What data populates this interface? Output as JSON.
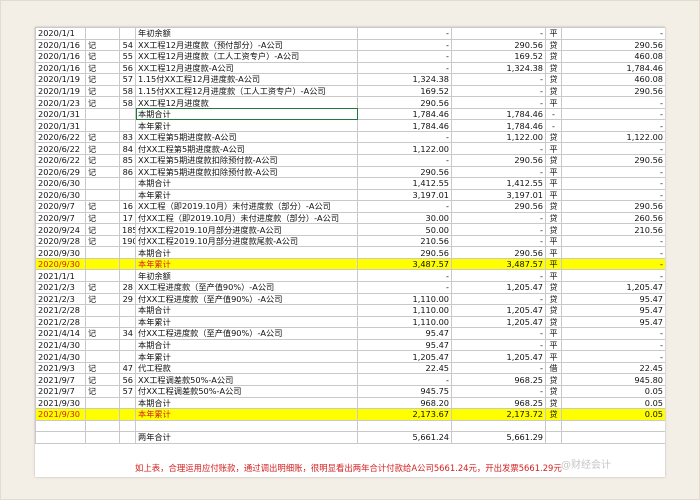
{
  "rows": [
    {
      "date": "2020/1/1",
      "type": "",
      "no": "",
      "summary": "年初余额",
      "debit": "-",
      "credit": "-",
      "dir": "平",
      "balance": "-"
    },
    {
      "date": "2020/1/16",
      "type": "记",
      "no": "54",
      "summary": "XX工程12月进度款（预付部分）-A公司",
      "debit": "-",
      "credit": "290.56",
      "dir": "贷",
      "balance": "290.56"
    },
    {
      "date": "2020/1/16",
      "type": "记",
      "no": "55",
      "summary": "XX工程12月进度款（工人工资专户）-A公司",
      "debit": "-",
      "credit": "169.52",
      "dir": "贷",
      "balance": "460.08"
    },
    {
      "date": "2020/1/16",
      "type": "记",
      "no": "56",
      "summary": "XX工程12月进度款-A公司",
      "debit": "-",
      "credit": "1,324.38",
      "dir": "贷",
      "balance": "1,784.46"
    },
    {
      "date": "2020/1/19",
      "type": "记",
      "no": "57",
      "summary": "1.15付XX工程12月进度款-A公司",
      "debit": "1,324.38",
      "credit": "-",
      "dir": "贷",
      "balance": "460.08"
    },
    {
      "date": "2020/1/19",
      "type": "记",
      "no": "58",
      "summary": "1.15付XX工程12月进度款（工人工资专户）-A公司",
      "debit": "169.52",
      "credit": "-",
      "dir": "贷",
      "balance": "290.56"
    },
    {
      "date": "2020/1/23",
      "type": "记",
      "no": "58",
      "summary": "XX工程12月进度款",
      "debit": "290.56",
      "credit": "-",
      "dir": "平",
      "balance": "-"
    },
    {
      "date": "2020/1/31",
      "type": "",
      "no": "",
      "summary": "本期合计",
      "debit": "1,784.46",
      "credit": "1,784.46",
      "dir": "-",
      "balance": "-",
      "selected": true
    },
    {
      "date": "2020/1/31",
      "type": "",
      "no": "",
      "summary": "本年累计",
      "debit": "1,784.46",
      "credit": "1,784.46",
      "dir": "-",
      "balance": "-"
    },
    {
      "date": "2020/6/22",
      "type": "记",
      "no": "83",
      "summary": "XX工程第5期进度款-A公司",
      "debit": "-",
      "credit": "1,122.00",
      "dir": "贷",
      "balance": "1,122.00"
    },
    {
      "date": "2020/6/22",
      "type": "记",
      "no": "84",
      "summary": "付XX工程第5期进度款-A公司",
      "debit": "1,122.00",
      "credit": "-",
      "dir": "平",
      "balance": "-"
    },
    {
      "date": "2020/6/22",
      "type": "记",
      "no": "85",
      "summary": "XX工程第5期进度款扣除预付款-A公司",
      "debit": "-",
      "credit": "290.56",
      "dir": "贷",
      "balance": "290.56"
    },
    {
      "date": "2020/6/29",
      "type": "记",
      "no": "86",
      "summary": "XX工程第5期进度款扣除预付款-A公司",
      "debit": "290.56",
      "credit": "-",
      "dir": "平",
      "balance": "-"
    },
    {
      "date": "2020/6/30",
      "type": "",
      "no": "",
      "summary": "本期合计",
      "debit": "1,412.55",
      "credit": "1,412.55",
      "dir": "平",
      "balance": "-"
    },
    {
      "date": "2020/6/30",
      "type": "",
      "no": "",
      "summary": "本年累计",
      "debit": "3,197.01",
      "credit": "3,197.01",
      "dir": "平",
      "balance": "-"
    },
    {
      "date": "2020/9/7",
      "type": "记",
      "no": "16",
      "summary": "XX工程（即2019.10月）未付进度款（部分）-A公司",
      "debit": "-",
      "credit": "290.56",
      "dir": "贷",
      "balance": "290.56"
    },
    {
      "date": "2020/9/7",
      "type": "记",
      "no": "17",
      "summary": "付XX工程（即2019.10月）未付进度款（部分）-A公司",
      "debit": "30.00",
      "credit": "-",
      "dir": "贷",
      "balance": "260.56"
    },
    {
      "date": "2020/9/24",
      "type": "记",
      "no": "185",
      "summary": "付XX工程2019.10月部分进度款-A公司",
      "debit": "50.00",
      "credit": "-",
      "dir": "贷",
      "balance": "210.56"
    },
    {
      "date": "2020/9/28",
      "type": "记",
      "no": "190",
      "summary": "付XX工程2019.10月部分进度款尾款-A公司",
      "debit": "210.56",
      "credit": "-",
      "dir": "平",
      "balance": "-"
    },
    {
      "date": "2020/9/30",
      "type": "",
      "no": "",
      "summary": "本期合计",
      "debit": "290.56",
      "credit": "290.56",
      "dir": "平",
      "balance": "-"
    },
    {
      "date": "2020/9/30",
      "type": "",
      "no": "",
      "summary": "本年累计",
      "debit": "3,487.57",
      "credit": "3,487.57",
      "dir": "平",
      "balance": "-",
      "highlight": true
    },
    {
      "date": "2021/1/1",
      "type": "",
      "no": "",
      "summary": "年初余额",
      "debit": "-",
      "credit": "-",
      "dir": "平",
      "balance": "-"
    },
    {
      "date": "2021/2/3",
      "type": "记",
      "no": "28",
      "summary": "XX工程进度款（至产值90%）-A公司",
      "debit": "-",
      "credit": "1,205.47",
      "dir": "贷",
      "balance": "1,205.47"
    },
    {
      "date": "2021/2/3",
      "type": "记",
      "no": "29",
      "summary": "付XX工程进度款（至产值90%）-A公司",
      "debit": "1,110.00",
      "credit": "-",
      "dir": "贷",
      "balance": "95.47"
    },
    {
      "date": "2021/2/28",
      "type": "",
      "no": "",
      "summary": "本期合计",
      "debit": "1,110.00",
      "credit": "1,205.47",
      "dir": "贷",
      "balance": "95.47"
    },
    {
      "date": "2021/2/28",
      "type": "",
      "no": "",
      "summary": "本年累计",
      "debit": "1,110.00",
      "credit": "1,205.47",
      "dir": "贷",
      "balance": "95.47"
    },
    {
      "date": "2021/4/14",
      "type": "记",
      "no": "34",
      "summary": "付XX工程进度款（至产值90%）-A公司",
      "debit": "95.47",
      "credit": "-",
      "dir": "平",
      "balance": "-"
    },
    {
      "date": "2021/4/30",
      "type": "",
      "no": "",
      "summary": "本期合计",
      "debit": "95.47",
      "credit": "-",
      "dir": "平",
      "balance": "-"
    },
    {
      "date": "2021/4/30",
      "type": "",
      "no": "",
      "summary": "本年累计",
      "debit": "1,205.47",
      "credit": "1,205.47",
      "dir": "平",
      "balance": "-"
    },
    {
      "date": "2021/9/3",
      "type": "记",
      "no": "47",
      "summary": "代工程款",
      "debit": "22.45",
      "credit": "-",
      "dir": "借",
      "balance": "22.45"
    },
    {
      "date": "2021/9/7",
      "type": "记",
      "no": "56",
      "summary": "XX工程调差款50%-A公司",
      "debit": "-",
      "credit": "968.25",
      "dir": "贷",
      "balance": "945.80"
    },
    {
      "date": "2021/9/7",
      "type": "记",
      "no": "57",
      "summary": "付XX工程调差款50%-A公司",
      "debit": "945.75",
      "credit": "-",
      "dir": "贷",
      "balance": "0.05"
    },
    {
      "date": "2021/9/30",
      "type": "",
      "no": "",
      "summary": "本期合计",
      "debit": "968.20",
      "credit": "968.25",
      "dir": "贷",
      "balance": "0.05"
    },
    {
      "date": "2021/9/30",
      "type": "",
      "no": "",
      "summary": "本年累计",
      "debit": "2,173.67",
      "credit": "2,173.72",
      "dir": "贷",
      "balance": "0.05",
      "highlight": true
    },
    {
      "date": "",
      "type": "",
      "no": "",
      "summary": "",
      "debit": "",
      "credit": "",
      "dir": "",
      "balance": ""
    },
    {
      "date": "",
      "type": "",
      "no": "",
      "summary": "两年合计",
      "debit": "5,661.24",
      "credit": "5,661.29",
      "dir": "",
      "balance": ""
    }
  ],
  "note": "如上表，合理运用应付账款，通过调出明细账，很明显看出两年合计付款给A公司5661.24元，开出发票5661.29元",
  "watermark": "@财经会计",
  "colors": {
    "highlight": "#ffff00",
    "highlight_text": "#d42020",
    "note_text": "#d42020",
    "selection_border": "#1e7a3c"
  }
}
